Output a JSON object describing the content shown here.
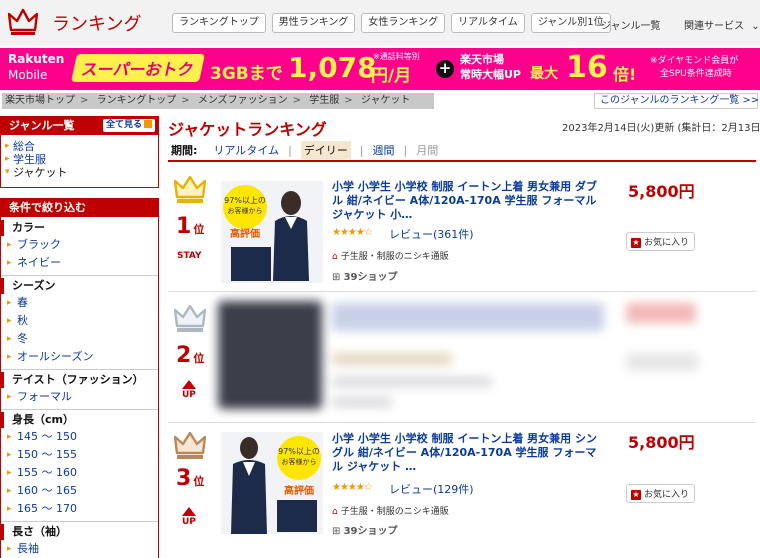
{
  "header": {
    "site_title": "ランキング",
    "tabs": [
      "ランキングトップ",
      "男性ランキング",
      "女性ランキング",
      "リアルタイム",
      "ジャンル別1位"
    ],
    "genre_list_link": "ジャンル一覧",
    "related_services": "関連サービス",
    "brand_color": "#bf0000"
  },
  "banner": {
    "brand_line1": "Rakuten",
    "brand_line2": "Mobile",
    "super_deal": "スーパーおトク",
    "data_plan": "3GBまで",
    "price": "1,078",
    "price_unit": "円/月",
    "tax_note": "※通話料等別",
    "ichiba_line1": "楽天市場",
    "ichiba_line2": "常時大幅UP",
    "max_label": "最大",
    "multiplier": "16",
    "multiplier_unit": "倍!",
    "note_line1": "※ダイヤモンド会員が",
    "note_line2": "全SPU条件達成時",
    "bg_color": "#ff008c"
  },
  "breadcrumb": [
    "楽天市場トップ",
    "ランキングトップ",
    "メンズファッション",
    "学生服",
    "ジャケット"
  ],
  "genre_ranking_link": "このジャンルのランキング一覧 >>",
  "sidebar": {
    "genre_box": {
      "title": "ジャンル一覧",
      "see_all": "全て見る",
      "items": [
        "総合",
        "学生服",
        "ジャケット"
      ]
    },
    "filter_box": {
      "title": "条件で絞り込む",
      "sections": [
        {
          "title": "カラー",
          "items": [
            "ブラック",
            "ネイビー"
          ]
        },
        {
          "title": "シーズン",
          "items": [
            "春",
            "秋",
            "冬",
            "オールシーズン"
          ]
        },
        {
          "title": "テイスト（ファッション）",
          "items": [
            "フォーマル"
          ]
        },
        {
          "title": "身長（cm）",
          "items": [
            "145 ～ 150",
            "150 ～ 155",
            "155 ～ 160",
            "160 ～ 165",
            "165 ～ 170"
          ]
        },
        {
          "title": "長さ（袖）",
          "items": [
            "長袖"
          ]
        }
      ]
    }
  },
  "main": {
    "title": "ジャケットランキング",
    "updated": "2023年2月14日(火)更新 (集計日：2月13日)",
    "period_label": "期間:",
    "periods": [
      "リアルタイム",
      "デイリー",
      "週間",
      "月間"
    ],
    "selected_period": "デイリー"
  },
  "items": [
    {
      "rank": "1",
      "rank_suffix": "位",
      "movement": "STAY",
      "crown": "gold",
      "title": "小学 小学生 小学校 制服 イートン上着 男女兼用 ダブル 紺/ネイビー A体/120A-170A 学生服 フォーマル ジャケット 小…",
      "stars": "★★★★☆",
      "review": "レビュー(361件)",
      "shop": "子生服・制服のニシキ通販",
      "shops_count": "39ショップ",
      "price": "5,800円",
      "favorite": "お気に入り",
      "badge_line1": "97%以上の",
      "badge_line2": "お客様から",
      "badge_line3": "高評価"
    },
    {
      "rank": "2",
      "rank_suffix": "位",
      "movement": "UP",
      "crown": "silver",
      "blurred": true
    },
    {
      "rank": "3",
      "rank_suffix": "位",
      "movement": "UP",
      "crown": "bronze",
      "title": "小学 小学生 小学校 制服 イートン上着 男女兼用 シングル 紺/ネイビー A体/120A-170A 学生服 フォーマル ジャケット …",
      "stars": "★★★★☆",
      "review": "レビュー(129件)",
      "shop": "子生服・制服のニシキ通販",
      "shops_count": "39ショップ",
      "price": "5,800円",
      "favorite": "お気に入り",
      "badge_line1": "97%以上の",
      "badge_line2": "お客様から",
      "badge_line3": "高評価"
    }
  ]
}
